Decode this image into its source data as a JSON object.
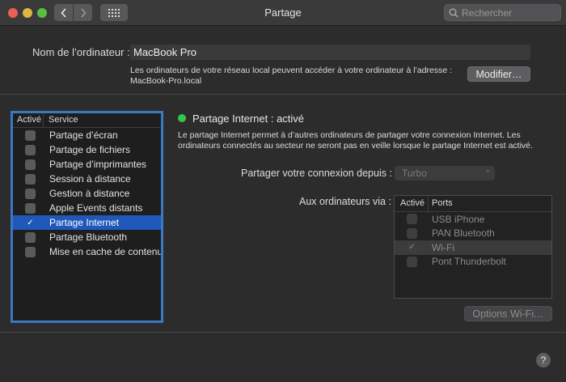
{
  "window": {
    "title": "Partage"
  },
  "search": {
    "placeholder": "Rechercher"
  },
  "computer": {
    "name_label": "Nom de l’ordinateur :",
    "name_value": "MacBook Pro",
    "address_text": "Les ordinateurs de votre réseau local peuvent accéder à votre ordinateur à l’adresse :",
    "address": "MacBook-Pro.local",
    "edit_button": "Modifier…"
  },
  "services": {
    "header_on": "Activé",
    "header_service": "Service",
    "items": [
      {
        "label": "Partage d’écran",
        "checked": false,
        "selected": false
      },
      {
        "label": "Partage de fichiers",
        "checked": false,
        "selected": false
      },
      {
        "label": "Partage d’imprimantes",
        "checked": false,
        "selected": false
      },
      {
        "label": "Session à distance",
        "checked": false,
        "selected": false
      },
      {
        "label": "Gestion à distance",
        "checked": false,
        "selected": false
      },
      {
        "label": "Apple Events distants",
        "checked": false,
        "selected": false
      },
      {
        "label": "Partage Internet",
        "checked": true,
        "selected": true
      },
      {
        "label": "Partage Bluetooth",
        "checked": false,
        "selected": false
      },
      {
        "label": "Mise en cache de contenu",
        "checked": false,
        "selected": false
      }
    ]
  },
  "detail": {
    "status": "Partage Internet : activé",
    "status_color": "#34c84a",
    "description": "Le partage Internet permet à d’autres ordinateurs de partager votre connexion Internet. Les ordinateurs connectés au secteur ne seront pas en veille lorsque le partage Internet est activé.",
    "share_from_label": "Partager votre connexion depuis :",
    "share_from_value": "Turbo",
    "to_computers_label": "Aux ordinateurs via :",
    "ports_header_on": "Activé",
    "ports_header_ports": "Ports",
    "ports": [
      {
        "label": "USB iPhone",
        "checked": false,
        "selected": false
      },
      {
        "label": "PAN Bluetooth",
        "checked": false,
        "selected": false
      },
      {
        "label": "Wi-Fi",
        "checked": true,
        "selected": true
      },
      {
        "label": "Pont Thunderbolt",
        "checked": false,
        "selected": false
      }
    ],
    "wifi_options_button": "Options Wi-Fi…"
  },
  "help": {
    "label": "?"
  }
}
